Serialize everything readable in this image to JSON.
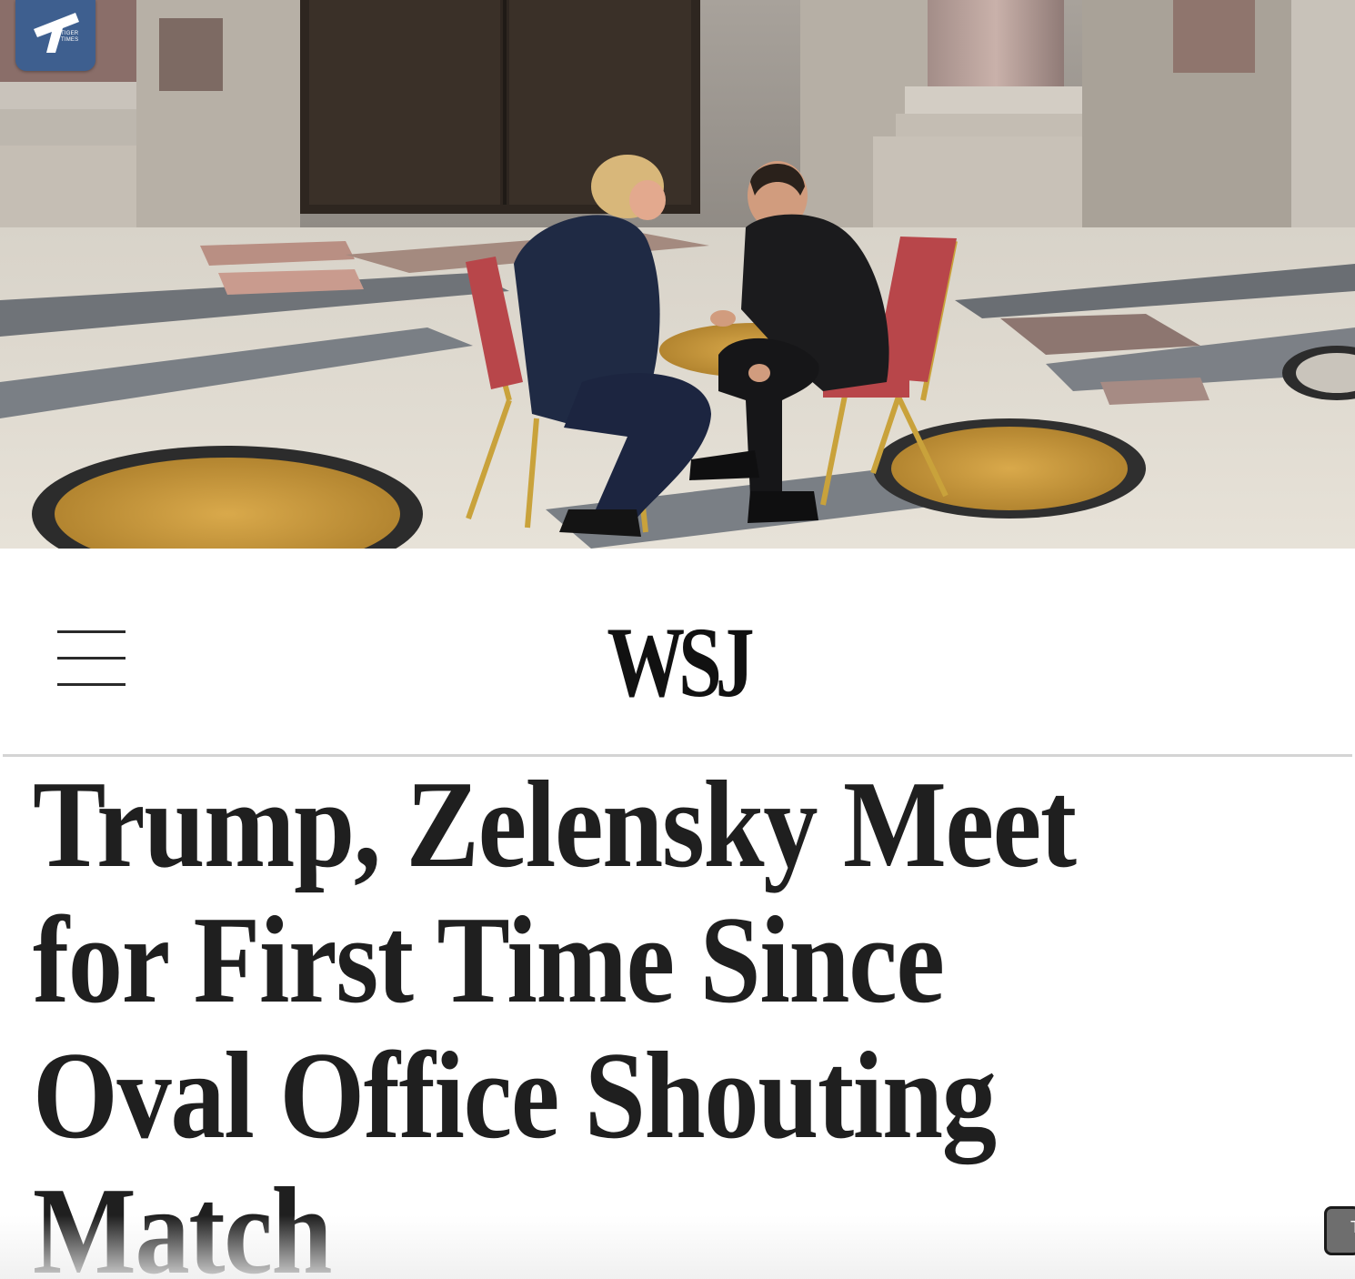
{
  "hero_photo": {
    "description_icon": "photo-of-two-men-seated-on-red-chairs"
  },
  "source_badge": {
    "logo_text": "TIGER TIMES",
    "color": "#3e5f8f"
  },
  "header": {
    "menu_icon": "hamburger-menu-icon",
    "brand": "WSJ"
  },
  "article": {
    "headline_lines": [
      "Trump, Zelensky Meet",
      "for First Time Since",
      "Oval Office Shouting",
      "Match"
    ]
  },
  "side_tab": {
    "glyph": "T"
  },
  "colors": {
    "headline": "#1f1f1f",
    "divider": "#d4d4d4",
    "badge": "#3e5f8f"
  }
}
